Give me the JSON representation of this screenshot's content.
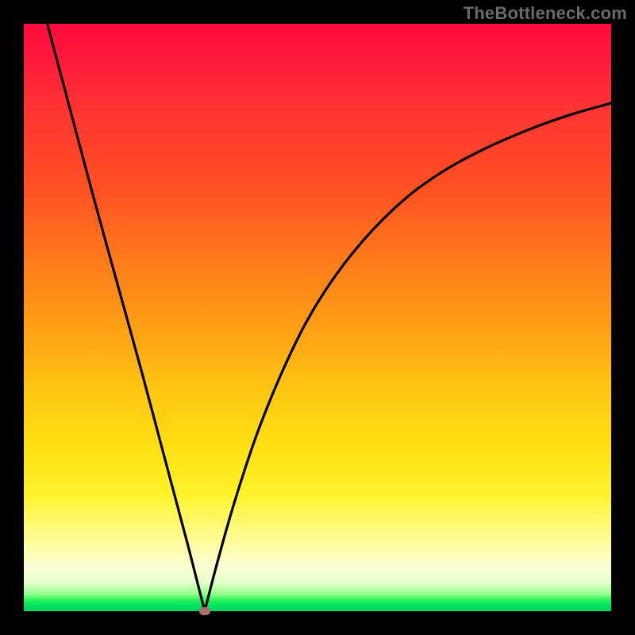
{
  "watermark": "TheBottleneck.com",
  "colors": {
    "frame": "#000000",
    "curve": "#000000",
    "marker": "#b46b6b",
    "gradient_top": "#ff0b3e",
    "gradient_bottom": "#00d45f"
  },
  "chart_data": {
    "type": "line",
    "title": "",
    "xlabel": "",
    "ylabel": "",
    "xlim": [
      0,
      100
    ],
    "ylim": [
      0,
      100
    ],
    "grid": false,
    "legend": false,
    "series": [
      {
        "name": "left-branch",
        "x": [
          4,
          8,
          12,
          16,
          20,
          24,
          28,
          30.8
        ],
        "values": [
          100,
          85,
          70,
          55.5,
          41,
          26,
          11,
          0
        ]
      },
      {
        "name": "right-branch",
        "x": [
          30.8,
          33,
          36,
          40,
          45,
          50,
          56,
          63,
          70,
          78,
          86,
          93,
          100
        ],
        "values": [
          0,
          8.5,
          19,
          31,
          43,
          52.5,
          61,
          68.5,
          74,
          78.5,
          82,
          84.5,
          86.5
        ]
      }
    ],
    "minimum_point": {
      "x": 30.8,
      "y": 0
    },
    "annotations": []
  }
}
